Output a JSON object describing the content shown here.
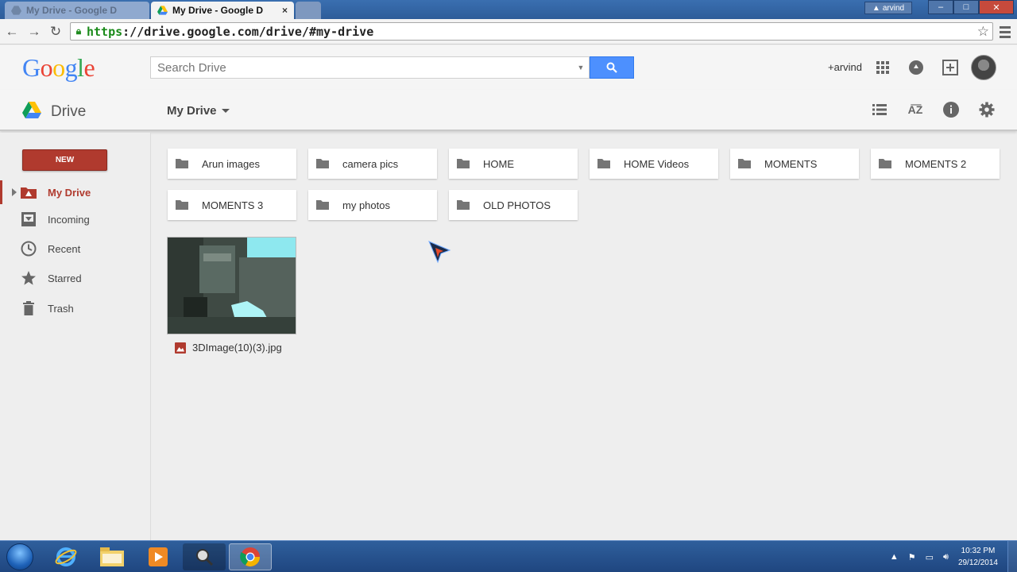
{
  "browser": {
    "tabs": [
      {
        "title": "My Drive - Google D",
        "state": "inactive"
      },
      {
        "title": "My Drive - Google D",
        "state": "active",
        "close": "×"
      }
    ],
    "window_user": "arvind",
    "url_scheme": "https",
    "url_rest": "://drive.google.com/drive/#my-drive"
  },
  "header": {
    "logo": "Google",
    "search_placeholder": "Search Drive",
    "user_name": "+arvind"
  },
  "drivebar": {
    "product": "Drive",
    "location": "My Drive"
  },
  "sidebar": {
    "new_label": "NEW",
    "items": [
      {
        "label": "My Drive",
        "icon": "my-drive-icon",
        "active": true
      },
      {
        "label": "Incoming",
        "icon": "incoming-icon",
        "active": false
      },
      {
        "label": "Recent",
        "icon": "clock-icon",
        "active": false
      },
      {
        "label": "Starred",
        "icon": "star-icon",
        "active": false
      },
      {
        "label": "Trash",
        "icon": "trash-icon",
        "active": false
      }
    ]
  },
  "folders": [
    "Arun images",
    "camera pics",
    "HOME",
    "HOME Videos",
    "MOMENTS",
    "MOMENTS 2",
    "MOMENTS 3",
    "my photos",
    "OLD PHOTOS"
  ],
  "files": [
    {
      "name": "3DImage(10)(3).jpg",
      "type": "image"
    }
  ],
  "taskbar": {
    "time": "10:32 PM",
    "date": "29/12/2014"
  },
  "colors": {
    "accent_red": "#b03a2e",
    "search_blue": "#4d90fe",
    "background": "#eeeeee"
  }
}
